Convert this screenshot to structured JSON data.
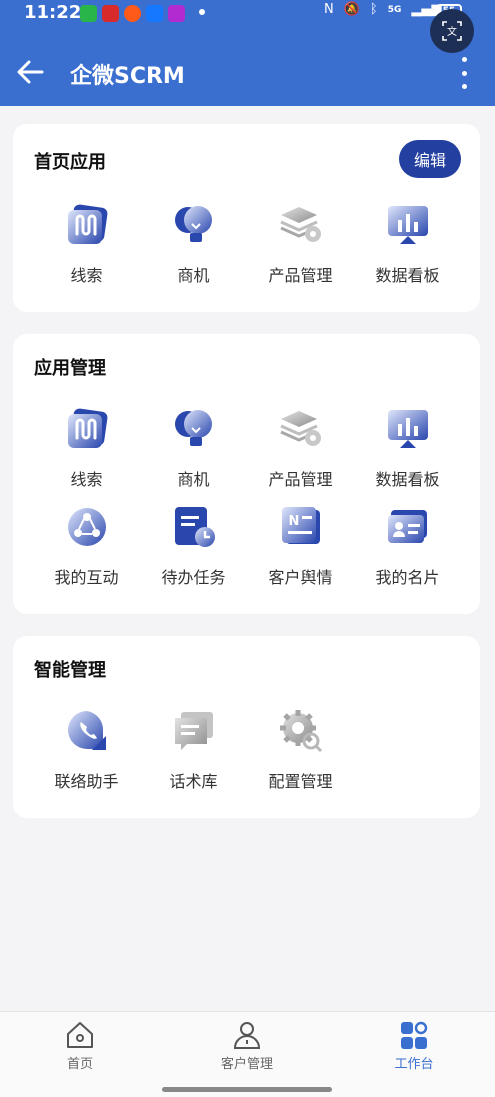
{
  "status_bar": {
    "time": "11:22",
    "network": "5G",
    "battery": "55"
  },
  "header": {
    "title": "企微SCRM"
  },
  "sections": {
    "home_apps": {
      "title": "首页应用",
      "edit_label": "编辑",
      "items": [
        {
          "label": "线索",
          "icon": "leads-icon"
        },
        {
          "label": "商机",
          "icon": "opportunity-icon"
        },
        {
          "label": "产品管理",
          "icon": "product-icon"
        },
        {
          "label": "数据看板",
          "icon": "dashboard-icon"
        }
      ]
    },
    "app_management": {
      "title": "应用管理",
      "items": [
        {
          "label": "线索",
          "icon": "leads-icon"
        },
        {
          "label": "商机",
          "icon": "opportunity-icon"
        },
        {
          "label": "产品管理",
          "icon": "product-icon"
        },
        {
          "label": "数据看板",
          "icon": "dashboard-icon"
        },
        {
          "label": "我的互动",
          "icon": "interaction-icon"
        },
        {
          "label": "待办任务",
          "icon": "todo-icon"
        },
        {
          "label": "客户舆情",
          "icon": "news-icon"
        },
        {
          "label": "我的名片",
          "icon": "business-card-icon"
        }
      ]
    },
    "smart_management": {
      "title": "智能管理",
      "items": [
        {
          "label": "联络助手",
          "icon": "phone-icon"
        },
        {
          "label": "话术库",
          "icon": "script-library-icon"
        },
        {
          "label": "配置管理",
          "icon": "settings-icon"
        }
      ]
    }
  },
  "tabbar": {
    "items": [
      {
        "label": "首页",
        "icon": "home-icon"
      },
      {
        "label": "客户管理",
        "icon": "person-icon"
      },
      {
        "label": "工作台",
        "icon": "workbench-icon",
        "active": true
      }
    ]
  },
  "colors": {
    "header": "#3a6fd0",
    "accent": "#2340a0",
    "icon_blue": "#3550b5",
    "icon_gray": "#9a9a9a"
  }
}
